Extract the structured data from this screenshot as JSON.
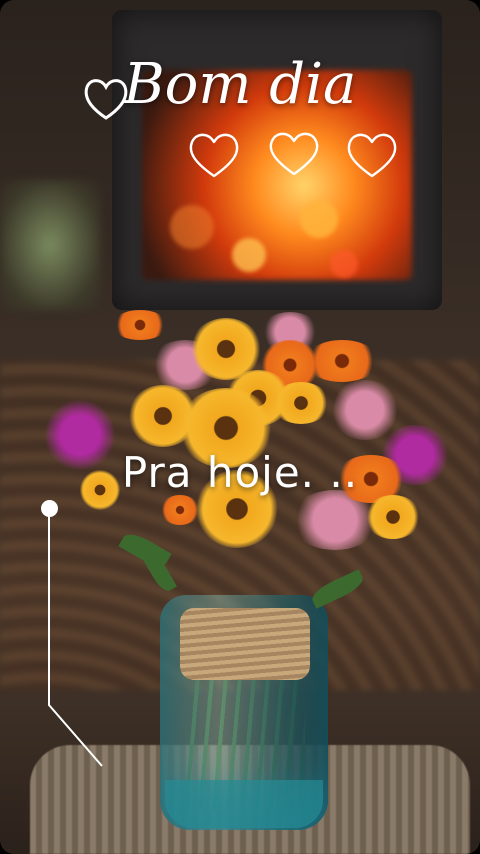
{
  "greeting": {
    "title": "Bom dia",
    "subtitle": "Pra hoje. .."
  },
  "decorations": {
    "hearts": [
      "heart-icon",
      "heart-icon",
      "heart-icon",
      "heart-icon"
    ]
  },
  "colors": {
    "text": "#ffffff",
    "fire": "#ff8a1e",
    "flowers": "#f2a81e"
  }
}
